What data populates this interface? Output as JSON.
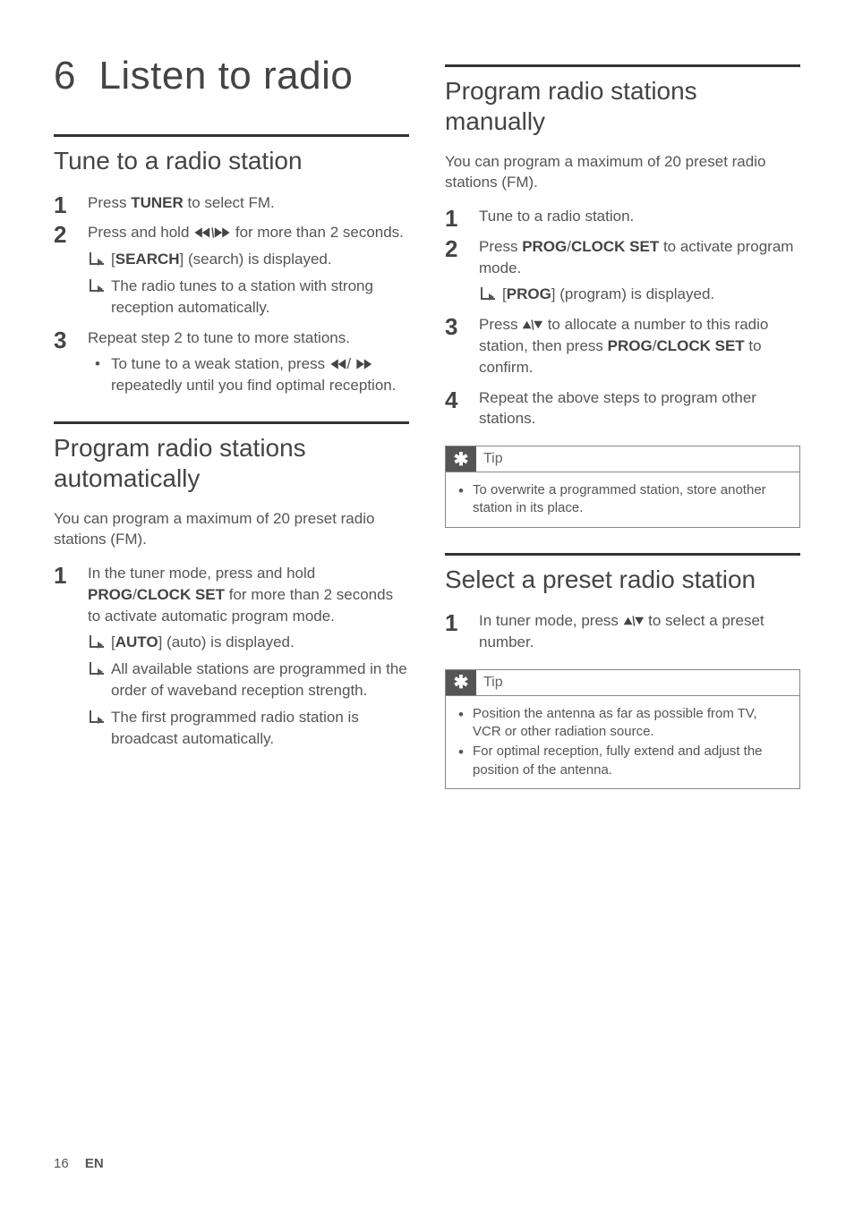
{
  "chapter": {
    "number": "6",
    "title": "Listen to radio"
  },
  "left": {
    "s1": {
      "heading": "Tune to a radio station",
      "step1_a": "Press ",
      "step1_b": "TUNER",
      "step1_c": " to select FM.",
      "step2_a": "Press and hold ",
      "step2_b": " for more than 2 seconds.",
      "step2_r1_a": "[",
      "step2_r1_b": "SEARCH",
      "step2_r1_c": "] (search) is displayed.",
      "step2_r2": "The radio tunes to a station with strong reception automatically.",
      "step3": "Repeat step 2 to tune to more stations.",
      "step3_bullet_a": "To tune to a weak station, press ",
      "step3_bullet_b": " repeatedly until you find optimal reception."
    },
    "s2": {
      "heading": "Program radio stations automatically",
      "intro": "You can program a maximum of 20 preset radio stations (FM).",
      "step1_a": "In the tuner mode, press and hold ",
      "step1_b": "PROG",
      "step1_c": "/",
      "step1_d": "CLOCK SET",
      "step1_e": " for more than 2 seconds to activate automatic program mode.",
      "step1_r1_a": "[",
      "step1_r1_b": "AUTO",
      "step1_r1_c": "] (auto) is displayed.",
      "step1_r2": "All available stations are programmed in the order of waveband reception strength.",
      "step1_r3": "The first programmed radio station is broadcast automatically."
    }
  },
  "right": {
    "s3": {
      "heading": "Program radio stations manually",
      "intro": "You can program a maximum of 20 preset radio stations (FM).",
      "step1": "Tune to a radio station.",
      "step2_a": "Press ",
      "step2_b": "PROG",
      "step2_c": "/",
      "step2_d": "CLOCK SET",
      "step2_e": " to activate program mode.",
      "step2_r1_a": "[",
      "step2_r1_b": "PROG",
      "step2_r1_c": "] (program) is displayed.",
      "step3_a": "Press ",
      "step3_b": " to allocate a number to this radio station, then press ",
      "step3_c": "PROG",
      "step3_d": "/",
      "step3_e": "CLOCK SET",
      "step3_f": " to confirm.",
      "step4": "Repeat the above steps to program other stations.",
      "tip_label": "Tip",
      "tip_body": "To overwrite a programmed station, store another station in its place."
    },
    "s4": {
      "heading": "Select a preset radio station",
      "step1_a": "In tuner mode, press ",
      "step1_b": " to select a preset number.",
      "tip_label": "Tip",
      "tip_b1": "Position the antenna as far as possible from TV, VCR or other radiation source.",
      "tip_b2": "For optimal reception, fully extend and adjust the position of the antenna."
    }
  },
  "footer": {
    "page": "16",
    "lang": "EN"
  },
  "icons": {
    "prev_next": "⏮/⏭",
    "prev": "⏮",
    "next": "⏭",
    "up_down": "▲/▼",
    "asterisk": "✱"
  }
}
